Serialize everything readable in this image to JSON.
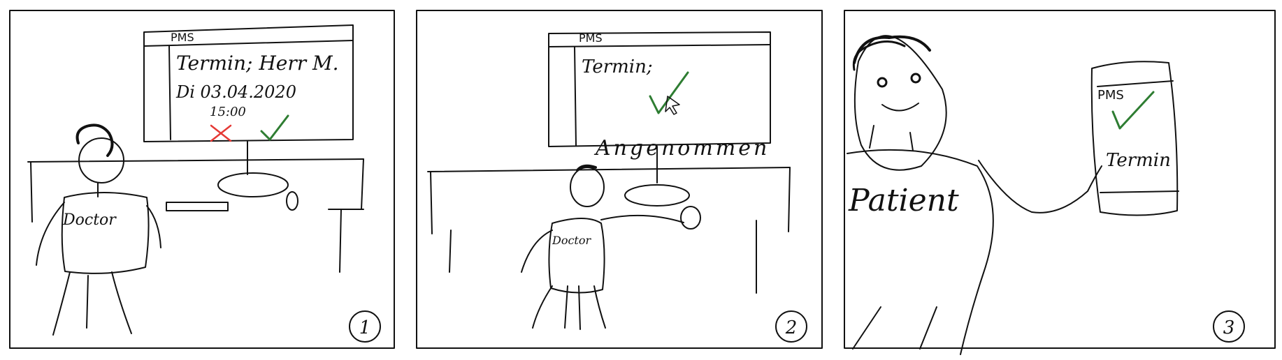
{
  "colors": {
    "ink": "#111111",
    "accept": "#2e7d32",
    "reject": "#e53935"
  },
  "panels": [
    {
      "number": "1",
      "screen": {
        "app": "PMS",
        "title": "Termin; Herr M.",
        "date": "Di 03.04.2020",
        "time": "15:00",
        "reject_icon": "x-mark",
        "accept_icon": "check-mark"
      },
      "shirt_label": "Doctor"
    },
    {
      "number": "2",
      "screen": {
        "app": "PMS",
        "title": "Termin;",
        "accept_icon": "check-mark"
      },
      "status": "Angenommen",
      "shirt_label": "Doctor"
    },
    {
      "number": "3",
      "shirt_label": "Patient",
      "phone": {
        "app": "PMS",
        "accept_icon": "check-mark",
        "label": "Termin"
      }
    }
  ]
}
